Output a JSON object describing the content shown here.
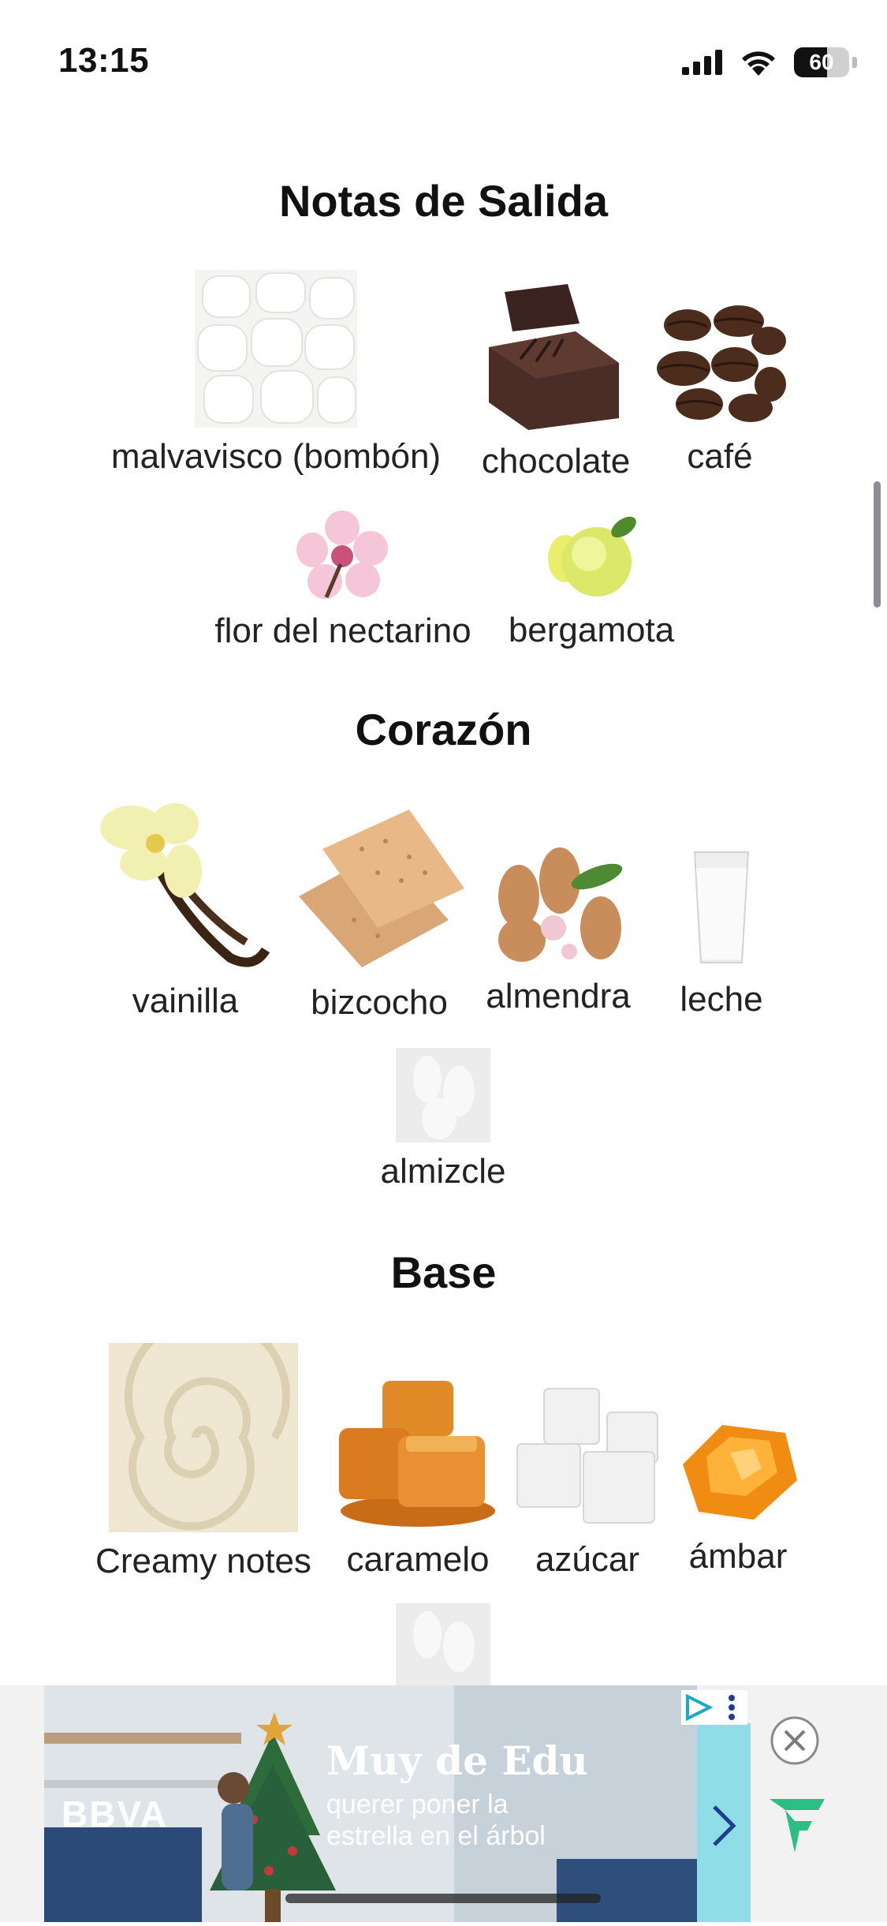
{
  "status_bar": {
    "time": "13:15",
    "battery": "60",
    "battery_level": 0.6
  },
  "sections": [
    {
      "title": "Notas de Salida"
    },
    {
      "title": "Corazón"
    },
    {
      "title": "Base"
    }
  ],
  "notes": {
    "salida": [
      "malvavisco (bombón)",
      "chocolate",
      "café",
      "flor del nectarino",
      "bergamota"
    ],
    "corazon": [
      "vainilla",
      "bizcocho",
      "almendra",
      "leche",
      "almizcle"
    ],
    "base": [
      "Creamy notes",
      "caramelo",
      "azúcar",
      "ámbar"
    ]
  },
  "ad": {
    "brand": "BBVA",
    "headline": "Muy de Edu",
    "line1": "querer poner la",
    "line2": "estrella en el árbol"
  },
  "colors": {
    "ad_accent": "#8fdde6",
    "ad_chevron": "#1f3c8f",
    "close_grey": "#8a8a8a",
    "green_logo": "#2bbf86"
  }
}
